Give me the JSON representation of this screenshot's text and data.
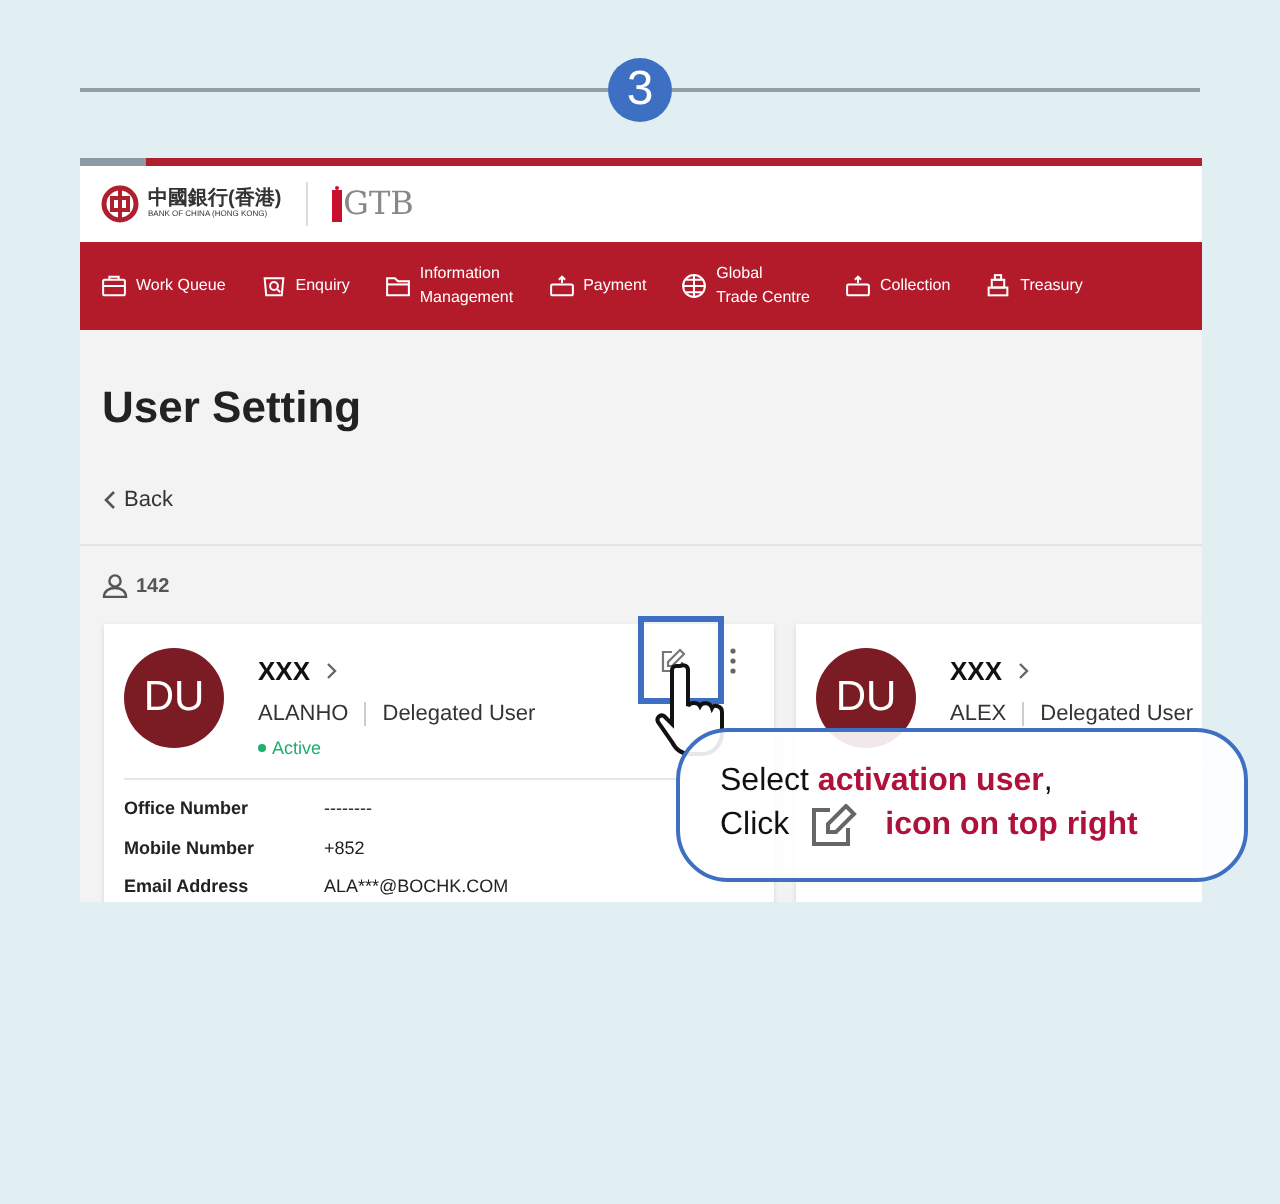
{
  "step": {
    "number": "3"
  },
  "header": {
    "bank_name_chinese": "中國銀行(香港)",
    "bank_name_english": "BANK OF CHINA (HONG KONG)",
    "product": "GTB"
  },
  "nav": [
    {
      "label": "Work Queue"
    },
    {
      "label": "Enquiry"
    },
    {
      "label": "Information\nManagement"
    },
    {
      "label": "Payment"
    },
    {
      "label": "Global\nTrade Centre"
    },
    {
      "label": "Collection"
    },
    {
      "label": "Treasury"
    }
  ],
  "page": {
    "title": "User Setting",
    "back": "Back",
    "user_count": "142"
  },
  "cards": [
    {
      "initials": "DU",
      "name": "XXX",
      "login": "ALANHO",
      "role": "Delegated User",
      "status": "Active",
      "active": true,
      "details": [
        {
          "label": "Office Number",
          "value": "--------"
        },
        {
          "label": "Mobile Number",
          "value": "+852"
        },
        {
          "label": "Email Address",
          "value": "ALA***@BOCHK.COM"
        }
      ]
    },
    {
      "initials": "DU",
      "name": "XXX",
      "login": "ALEX",
      "role": "Delegated User"
    }
  ],
  "callout": {
    "line_1": "Select **activation user**,",
    "click": "Click",
    "action": "icon on top right"
  }
}
